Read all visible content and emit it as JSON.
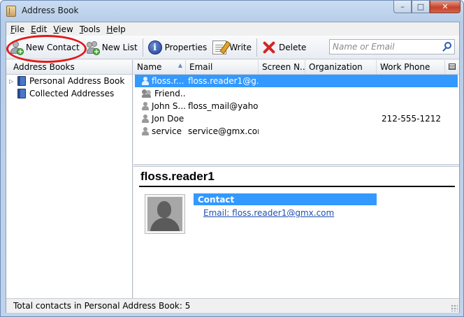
{
  "window": {
    "title": "Address Book",
    "controls": {
      "minimize": "–",
      "maximize": "□",
      "close": "✕"
    }
  },
  "menubar": {
    "items": [
      {
        "label_u": "F",
        "label_rest": "ile"
      },
      {
        "label_u": "E",
        "label_rest": "dit"
      },
      {
        "label_u": "V",
        "label_rest": "iew"
      },
      {
        "label_u": "T",
        "label_rest": "ools"
      },
      {
        "label_u": "H",
        "label_rest": "elp"
      }
    ]
  },
  "toolbar": {
    "new_contact": "New Contact",
    "new_list": "New List",
    "properties": "Properties",
    "write": "Write",
    "delete": "Delete",
    "search_placeholder": "Name or Email"
  },
  "sidebar": {
    "header": "Address Books",
    "books": [
      {
        "label": "Personal Address Book",
        "expandable": true
      },
      {
        "label": "Collected Addresses",
        "expandable": false
      }
    ]
  },
  "contacts": {
    "columns": {
      "name": "Name",
      "email": "Email",
      "screen_name": "Screen N...",
      "organization": "Organization",
      "work_phone": "Work Phone"
    },
    "rows": [
      {
        "type": "person",
        "name": "floss.r...",
        "email": "floss.reader1@g...",
        "screen_name": "",
        "organization": "",
        "work_phone": "",
        "selected": true
      },
      {
        "type": "list",
        "name": "Friend...",
        "email": "",
        "screen_name": "",
        "organization": "",
        "work_phone": "",
        "selected": false
      },
      {
        "type": "person",
        "name": "John S...",
        "email": "floss_mail@yaho...",
        "screen_name": "",
        "organization": "",
        "work_phone": "",
        "selected": false
      },
      {
        "type": "person",
        "name": "Jon Doe",
        "email": "",
        "screen_name": "",
        "organization": "",
        "work_phone": "212-555-1212",
        "selected": false
      },
      {
        "type": "person",
        "name": "service",
        "email": "service@gmx.com",
        "screen_name": "",
        "organization": "",
        "work_phone": "",
        "selected": false
      }
    ]
  },
  "card": {
    "display_name": "floss.reader1",
    "section_title": "Contact",
    "email_line": "Email: floss.reader1@gmx.com"
  },
  "status": {
    "text": "Total contacts in Personal Address Book: 5"
  },
  "colors": {
    "selection": "#3399ff",
    "highlight_ring": "#e01a1a",
    "link": "#1f4fb0"
  }
}
